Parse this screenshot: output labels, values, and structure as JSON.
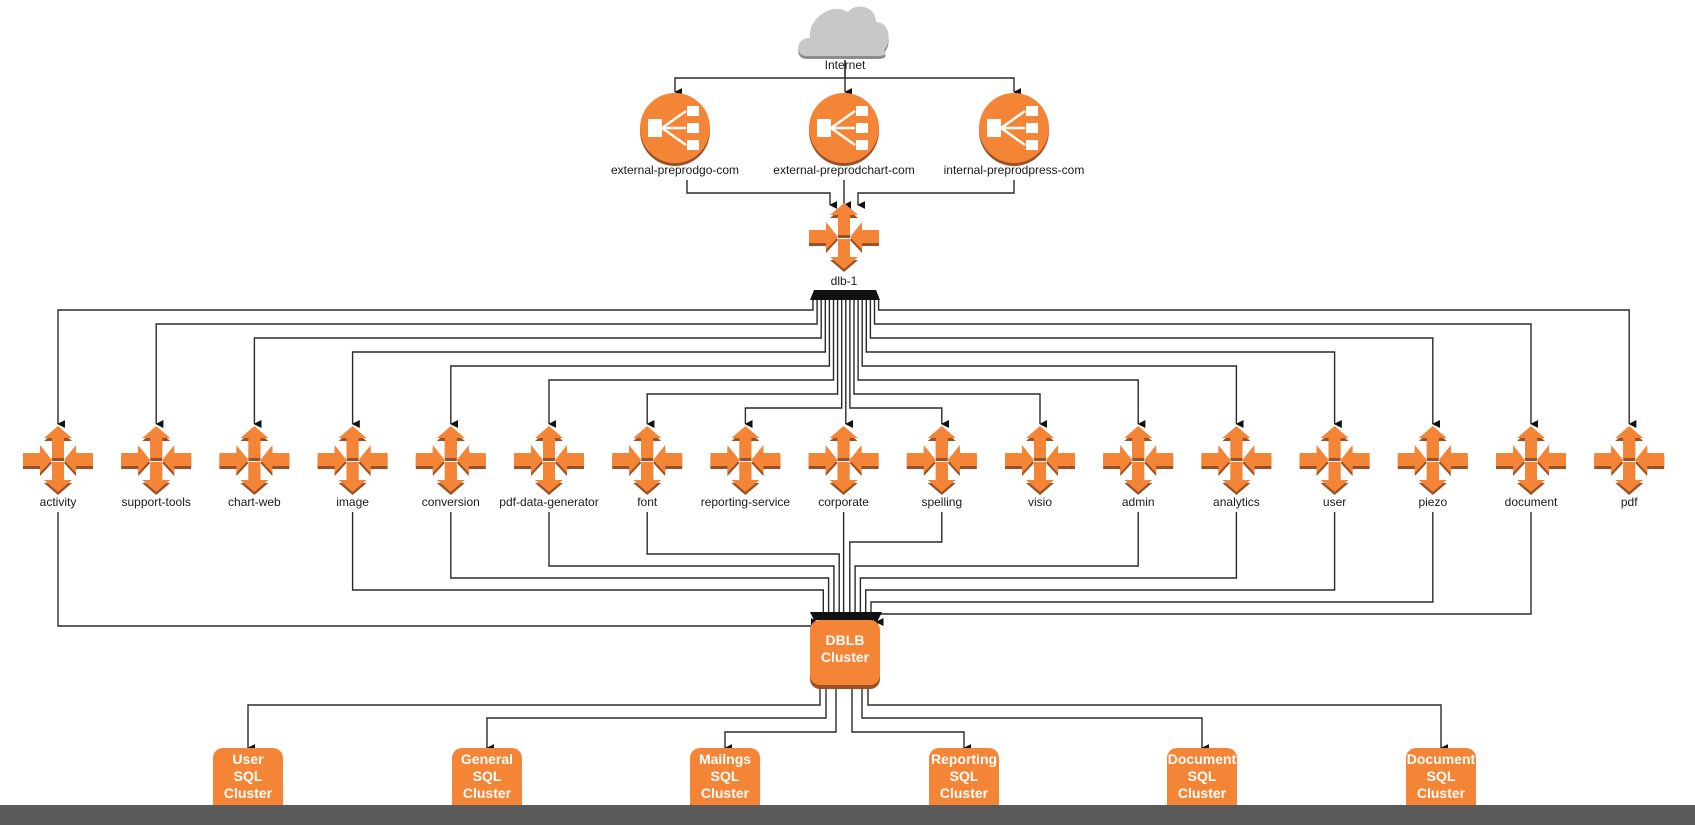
{
  "diagram": {
    "colors": {
      "orange": "#f58536",
      "orange_dark": "#9d5025",
      "cloud": "#c8c8c9",
      "cloud_dark": "#8c8c8c",
      "edge": "#2a2a2a",
      "bottom_bar": "#5a5a5a"
    },
    "internet": {
      "label": "Internet",
      "icon": "cloud-icon"
    },
    "load_balancers": [
      {
        "id": "lb1",
        "label": "external-preprodgo-com",
        "icon": "elastic-load-balancer-icon"
      },
      {
        "id": "lb2",
        "label": "external-preprodchart-com",
        "icon": "elastic-load-balancer-icon"
      },
      {
        "id": "lb3",
        "label": "internal-preprodpress-com",
        "icon": "elastic-load-balancer-icon"
      }
    ],
    "hub": {
      "id": "dlb1",
      "label": "dlb-1",
      "icon": "auto-scaling-arrows-icon"
    },
    "services": [
      {
        "id": "activity",
        "label": "activity",
        "to_dblb": true
      },
      {
        "id": "support-tools",
        "label": "support-tools",
        "to_dblb": false
      },
      {
        "id": "chart-web",
        "label": "chart-web",
        "to_dblb": false
      },
      {
        "id": "image",
        "label": "image",
        "to_dblb": true
      },
      {
        "id": "conversion",
        "label": "conversion",
        "to_dblb": true
      },
      {
        "id": "pdf-data-generator",
        "label": "pdf-data-generator",
        "to_dblb": true
      },
      {
        "id": "font",
        "label": "font",
        "to_dblb": true
      },
      {
        "id": "reporting-service",
        "label": "reporting-service",
        "to_dblb": false
      },
      {
        "id": "corporate",
        "label": "corporate",
        "to_dblb": true
      },
      {
        "id": "spelling",
        "label": "spelling",
        "to_dblb": true
      },
      {
        "id": "visio",
        "label": "visio",
        "to_dblb": false
      },
      {
        "id": "admin",
        "label": "admin",
        "to_dblb": true
      },
      {
        "id": "analytics",
        "label": "analytics",
        "to_dblb": true
      },
      {
        "id": "user",
        "label": "user",
        "to_dblb": true
      },
      {
        "id": "piezo",
        "label": "piezo",
        "to_dblb": true
      },
      {
        "id": "document",
        "label": "document",
        "to_dblb": true
      },
      {
        "id": "pdf",
        "label": "pdf",
        "to_dblb": false
      }
    ],
    "dblb": {
      "id": "dblb",
      "label_lines": [
        "DBLB",
        "Cluster"
      ]
    },
    "sql_clusters": [
      {
        "id": "sql-user",
        "label_lines": [
          "User",
          "SQL",
          "Cluster"
        ]
      },
      {
        "id": "sql-general",
        "label_lines": [
          "General",
          "SQL",
          "Cluster"
        ]
      },
      {
        "id": "sql-mailings",
        "label_lines": [
          "Mailngs",
          "SQL",
          "Cluster"
        ]
      },
      {
        "id": "sql-reporting",
        "label_lines": [
          "Reporting",
          "SQL",
          "Cluster"
        ]
      },
      {
        "id": "sql-document-1",
        "label_lines": [
          "Document",
          "SQL",
          "Cluster"
        ]
      },
      {
        "id": "sql-document-2",
        "label_lines": [
          "Document",
          "SQL",
          "Cluster"
        ]
      }
    ]
  }
}
